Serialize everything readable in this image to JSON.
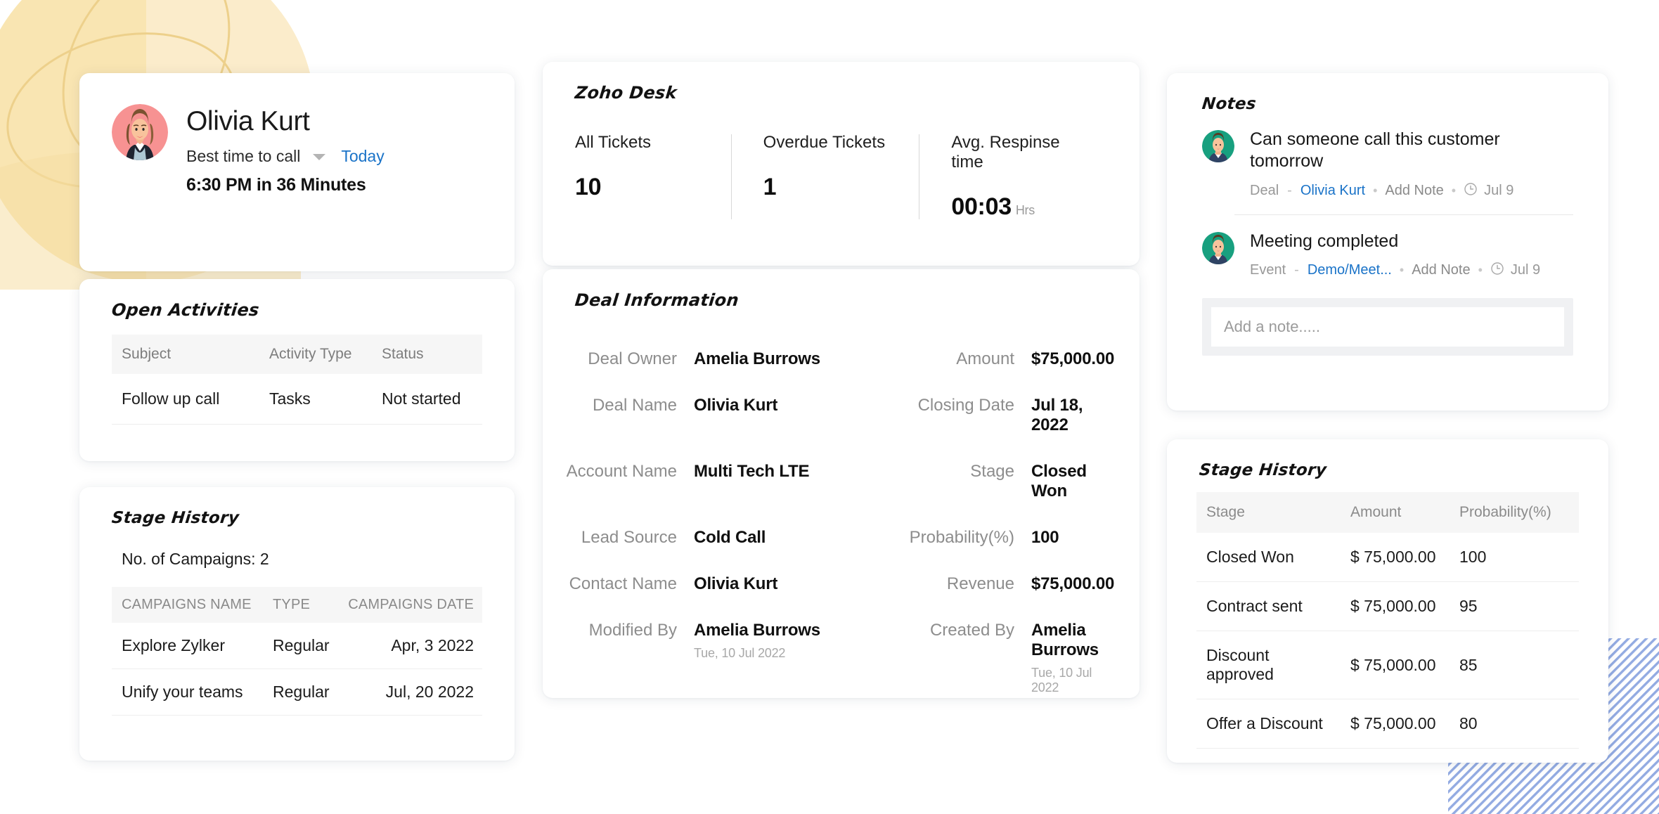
{
  "profile": {
    "name": "Olivia Kurt",
    "best_time_label": "Best time to call",
    "today_link": "Today",
    "time_detail": "6:30 PM in 36 Minutes",
    "avatar_icon": "woman-avatar",
    "caret_icon": "chevron-down-icon"
  },
  "open_activities": {
    "heading": "Open Activities",
    "columns": [
      "Subject",
      "Activity Type",
      "Status"
    ],
    "rows": [
      {
        "subject": "Follow up call",
        "activity_type": "Tasks",
        "status": "Not started"
      }
    ]
  },
  "stage_history_left": {
    "heading": "Stage History",
    "campaign_count_label": "No. of Campaigns: 2",
    "columns": [
      "CAMPAIGNS NAME",
      "TYPE",
      "CAMPAIGNS DATE"
    ],
    "rows": [
      {
        "name": "Explore Zylker",
        "type": "Regular",
        "date": "Apr, 3 2022"
      },
      {
        "name": "Unify your teams",
        "type": "Regular",
        "date": "Jul, 20 2022"
      }
    ]
  },
  "zoho_desk": {
    "heading": "Zoho Desk",
    "stats": [
      {
        "label": "All Tickets",
        "value": "10",
        "unit": ""
      },
      {
        "label": "Overdue Tickets",
        "value": "1",
        "unit": ""
      },
      {
        "label": "Avg. Respinse time",
        "value": "00:03",
        "unit": "Hrs"
      }
    ]
  },
  "deal_information": {
    "heading": "Deal Information",
    "rows": [
      {
        "left_label": "Deal Owner",
        "left_value": "Amelia Burrows",
        "left_link": false,
        "left_sub": "",
        "right_label": "Amount",
        "right_value": "$75,000.00",
        "right_link": false,
        "right_sub": ""
      },
      {
        "left_label": "Deal Name",
        "left_value": "Olivia Kurt",
        "left_link": false,
        "left_sub": "",
        "right_label": "Closing Date",
        "right_value": "Jul 18, 2022",
        "right_link": false,
        "right_sub": ""
      },
      {
        "left_label": "Account Name",
        "left_value": "Multi Tech LTE",
        "left_link": true,
        "left_sub": "",
        "right_label": "Stage",
        "right_value": "Closed Won",
        "right_link": false,
        "right_sub": ""
      },
      {
        "left_label": "Lead Source",
        "left_value": "Cold Call",
        "left_link": false,
        "left_sub": "",
        "right_label": "Probability(%)",
        "right_value": "100",
        "right_link": false,
        "right_sub": ""
      },
      {
        "left_label": "Contact Name",
        "left_value": "Olivia Kurt",
        "left_link": true,
        "left_sub": "",
        "right_label": "Revenue",
        "right_value": "$75,000.00",
        "right_link": false,
        "right_sub": ""
      },
      {
        "left_label": "Modified By",
        "left_value": "Amelia Burrows",
        "left_link": false,
        "left_sub": "Tue, 10 Jul 2022",
        "right_label": "Created By",
        "right_value": "Amelia Burrows",
        "right_link": false,
        "right_sub": "Tue, 10 Jul 2022"
      }
    ]
  },
  "notes": {
    "heading": "Notes",
    "items": [
      {
        "avatar_icon": "man-avatar",
        "text": "Can someone call this customer tomorrow",
        "module": "Deal",
        "record": "Olivia Kurt",
        "action": "Add Note",
        "clock_icon": "clock-icon",
        "date": "Jul 9"
      },
      {
        "avatar_icon": "man-avatar",
        "text": "Meeting completed",
        "module": "Event",
        "record": "Demo/Meet...",
        "action": "Add Note",
        "clock_icon": "clock-icon",
        "date": "Jul 9"
      }
    ],
    "input_placeholder": "Add a note....."
  },
  "stage_history_right": {
    "heading": "Stage History",
    "columns": [
      "Stage",
      "Amount",
      "Probability(%)"
    ],
    "rows": [
      {
        "stage": "Closed Won",
        "amount": "$ 75,000.00",
        "probability": "100"
      },
      {
        "stage": "Contract sent",
        "amount": "$ 75,000.00",
        "probability": "95"
      },
      {
        "stage": "Discount approved",
        "amount": "$ 75,000.00",
        "probability": "85"
      },
      {
        "stage": "Offer a Discount",
        "amount": "$ 75,000.00",
        "probability": "80"
      }
    ]
  },
  "colors": {
    "link": "#1a73c8",
    "accent_yellow": "#f7e3ae",
    "accent_blue_hatch": "#8fa8e0",
    "avatar_pink": "#f79292",
    "avatar_green": "#18a07f",
    "muted": "#8d8d8d"
  },
  "decor": {
    "yellow_blob": "yellow-circle-decoration",
    "hatch": "diagonal-hatch-decoration"
  }
}
